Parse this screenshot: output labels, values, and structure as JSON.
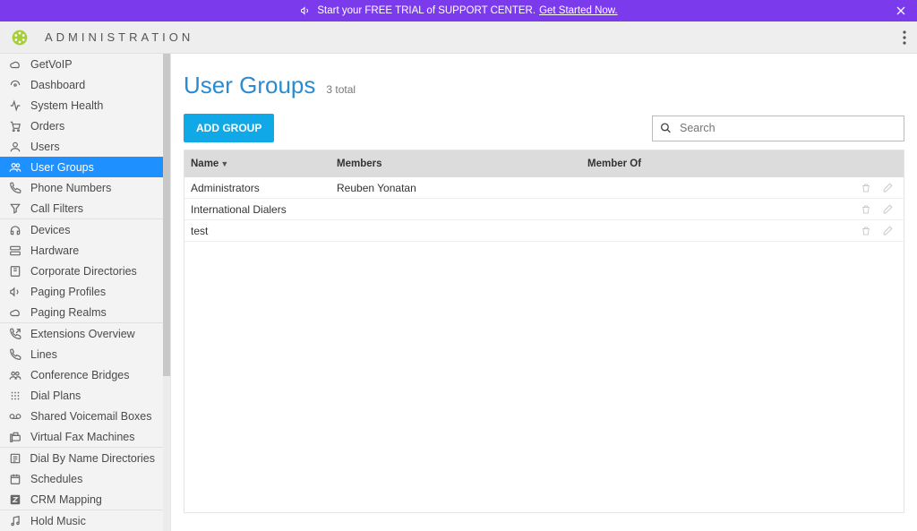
{
  "banner": {
    "text": "Start your FREE TRIAL of SUPPORT CENTER.",
    "cta": "Get Started Now."
  },
  "header": {
    "title": "ADMINISTRATION"
  },
  "sidebar": {
    "items": [
      {
        "label": "GetVoIP",
        "icon": "cloud"
      },
      {
        "label": "Dashboard",
        "icon": "gauge"
      },
      {
        "label": "System Health",
        "icon": "activity"
      },
      {
        "label": "Orders",
        "icon": "cart"
      },
      {
        "label": "Users",
        "icon": "user"
      },
      {
        "label": "User Groups",
        "icon": "users",
        "active": true
      },
      {
        "label": "Phone Numbers",
        "icon": "phone"
      },
      {
        "label": "Call Filters",
        "icon": "filter"
      },
      {
        "label": "Devices",
        "icon": "headset",
        "divider_before": true
      },
      {
        "label": "Hardware",
        "icon": "server"
      },
      {
        "label": "Corporate Directories",
        "icon": "book"
      },
      {
        "label": "Paging Profiles",
        "icon": "megaphone"
      },
      {
        "label": "Paging Realms",
        "icon": "cloud"
      },
      {
        "label": "Extensions Overview",
        "icon": "phone-fwd",
        "divider_before": true
      },
      {
        "label": "Lines",
        "icon": "phone2"
      },
      {
        "label": "Conference Bridges",
        "icon": "users2"
      },
      {
        "label": "Dial Plans",
        "icon": "dialpad"
      },
      {
        "label": "Shared Voicemail Boxes",
        "icon": "voicemail"
      },
      {
        "label": "Virtual Fax Machines",
        "icon": "fax"
      },
      {
        "label": "Dial By Name Directories",
        "icon": "list",
        "divider_before": true
      },
      {
        "label": "Schedules",
        "icon": "calendar"
      },
      {
        "label": "CRM Mapping",
        "icon": "z"
      },
      {
        "label": "Hold Music",
        "icon": "music",
        "divider_before": true
      }
    ]
  },
  "page": {
    "title": "User Groups",
    "subtitle": "3 total",
    "add_label": "ADD GROUP",
    "search_placeholder": "Search"
  },
  "table": {
    "columns": {
      "name": "Name",
      "members": "Members",
      "member_of": "Member Of"
    },
    "rows": [
      {
        "name": "Administrators",
        "members": "Reuben Yonatan",
        "member_of": ""
      },
      {
        "name": "International Dialers",
        "members": "",
        "member_of": ""
      },
      {
        "name": "test",
        "members": "",
        "member_of": ""
      }
    ]
  }
}
